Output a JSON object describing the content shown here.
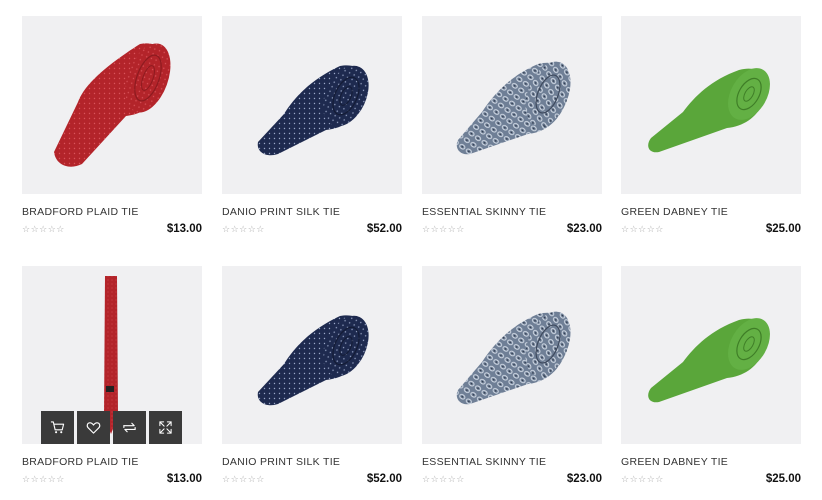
{
  "products": [
    {
      "name": "BRADFORD PLAID TIE",
      "price": "$13.00",
      "rating": "☆☆☆☆☆"
    },
    {
      "name": "DANIO PRINT SILK TIE",
      "price": "$52.00",
      "rating": "☆☆☆☆☆"
    },
    {
      "name": "ESSENTIAL SKINNY TIE",
      "price": "$23.00",
      "rating": "☆☆☆☆☆"
    },
    {
      "name": "GREEN DABNEY TIE",
      "price": "$25.00",
      "rating": "☆☆☆☆☆"
    },
    {
      "name": "BRADFORD PLAID TIE",
      "price": "$13.00",
      "rating": "☆☆☆☆☆"
    },
    {
      "name": "DANIO PRINT SILK TIE",
      "price": "$52.00",
      "rating": "☆☆☆☆☆"
    },
    {
      "name": "ESSENTIAL SKINNY TIE",
      "price": "$23.00",
      "rating": "☆☆☆☆☆"
    },
    {
      "name": "GREEN DABNEY TIE",
      "price": "$25.00",
      "rating": "☆☆☆☆☆"
    }
  ],
  "hover_actions": {
    "icons": [
      "cart-icon",
      "heart-icon",
      "compare-icon",
      "expand-icon"
    ]
  },
  "colors": {
    "thumb_bg": "#f0f0f2",
    "red_tie": "#b3242a",
    "navy_tie": "#1e2a4f",
    "patterned_tie": "#6f7f96",
    "green_tie": "#5aa63a",
    "action_bg": "#3a3a3a"
  }
}
